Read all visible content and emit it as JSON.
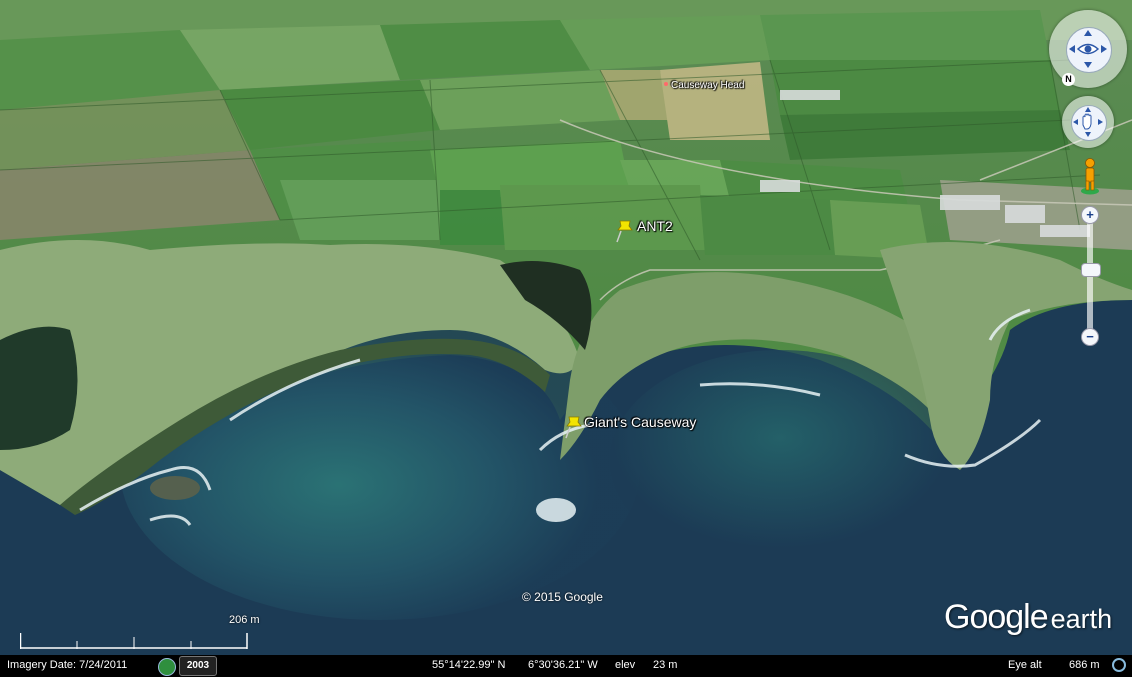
{
  "map": {
    "places": [
      {
        "label": "ANT2"
      },
      {
        "label": "Giant's Causeway"
      },
      {
        "label": "Causeway Head"
      }
    ],
    "copyright": "© 2015 Google",
    "logo": {
      "word1": "Google",
      "word2": "earth"
    },
    "scale": {
      "label": "206 m"
    }
  },
  "status_bar": {
    "imagery_date": "Imagery Date: 7/24/2011",
    "year": "2003",
    "latitude": "55°14'22.99\" N",
    "longitude": "6°30'36.21\" W",
    "elev_label": "elev",
    "elev_value": "23 m",
    "eye_alt_label": "Eye alt",
    "eye_alt_value": "686 m"
  },
  "navigation": {
    "north_label": "N",
    "zoom_in": "+",
    "zoom_out": "−",
    "zoom_level": 0.5
  },
  "colors": {
    "sea_deep": "#1b3a55",
    "sea_shallow": "#2f7a7a",
    "field_green": "#5a9a4a",
    "cliff_grass": "#8aa878",
    "pin_yellow": "#f2e400"
  }
}
